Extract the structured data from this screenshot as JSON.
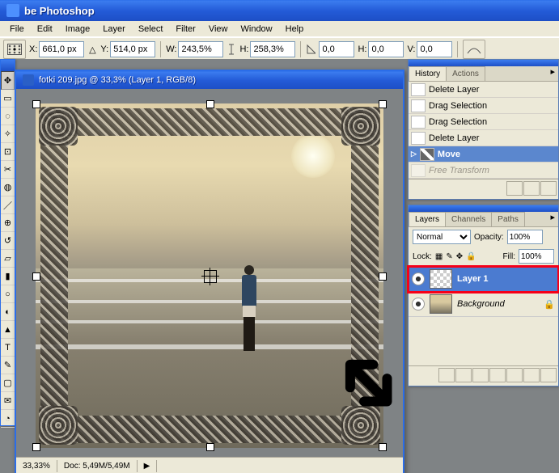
{
  "app": {
    "title": "be Photoshop"
  },
  "menu": [
    "File",
    "Edit",
    "Image",
    "Layer",
    "Select",
    "Filter",
    "View",
    "Window",
    "Help"
  ],
  "options": {
    "x_label": "X:",
    "x": "661,0 px",
    "y_label": "Y:",
    "y": "514,0 px",
    "w_label": "W:",
    "w": "243,5%",
    "h_label": "H:",
    "h": "258,3%",
    "angle_label": "",
    "angle": "0,0",
    "hskew_label": "H:",
    "hskew": "0,0",
    "vskew_label": "V:",
    "vskew": "0,0"
  },
  "doc": {
    "title": "fotki 209.jpg @ 33,3% (Layer 1, RGB/8)",
    "zoom": "33,33%",
    "docSize": "Doc: 5,49M/5,49M"
  },
  "history": {
    "tabs": [
      "History",
      "Actions"
    ],
    "items": [
      {
        "label": "Delete Layer",
        "icon": "delete"
      },
      {
        "label": "Drag Selection",
        "icon": "drag"
      },
      {
        "label": "Drag Selection",
        "icon": "drag"
      },
      {
        "label": "Delete Layer",
        "icon": "delete"
      },
      {
        "label": "Move",
        "icon": "move",
        "sel": true
      },
      {
        "label": "Free Transform",
        "icon": "ft",
        "dim": true
      }
    ]
  },
  "layers": {
    "tabs": [
      "Layers",
      "Channels",
      "Paths"
    ],
    "blend": "Normal",
    "opacityLabel": "Opacity:",
    "opacity": "100%",
    "fillLabel": "Fill:",
    "fill": "100%",
    "lockLabel": "Lock:",
    "items": [
      {
        "name": "Layer 1",
        "sel": true,
        "hl": true,
        "thumb": "checker"
      },
      {
        "name": "Background",
        "lock": true,
        "italic": true,
        "thumb": "bg"
      }
    ]
  }
}
